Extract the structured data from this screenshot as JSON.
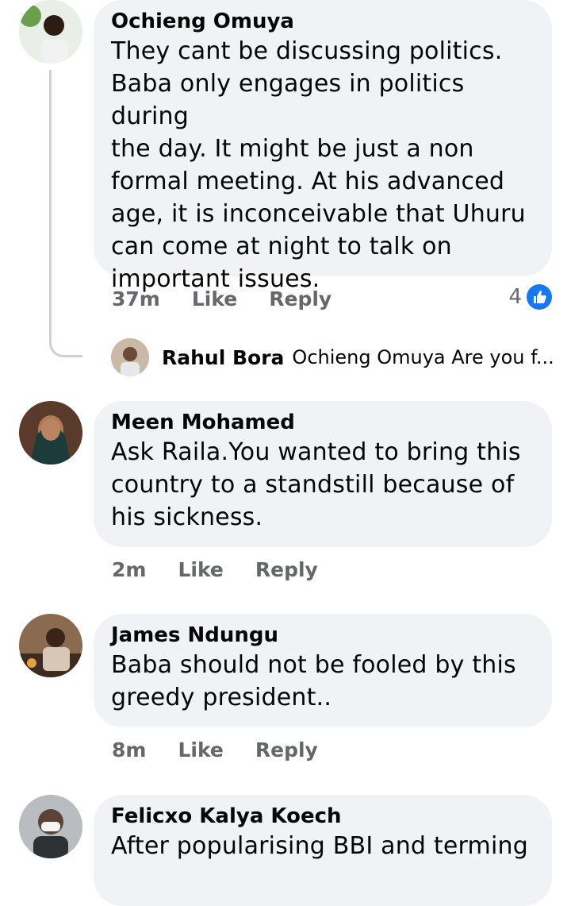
{
  "comments": [
    {
      "author": "Ochieng Omuya",
      "lines": [
        "They cant be discussing politics.",
        "Baba only engages in politics during",
        "the day. It might be just a non",
        "formal meeting. At his advanced",
        "age, it is inconceivable that Uhuru",
        "can come at night to talk on",
        "important issues."
      ],
      "time": "37m",
      "like_label": "Like",
      "reply_label": "Reply",
      "reaction_count": "4",
      "reply_preview": {
        "author": "Rahul Bora",
        "snippet": "Ochieng Omuya Are you f..."
      }
    },
    {
      "author": "Meen Mohamed",
      "lines": [
        "Ask Raila.You wanted to bring this",
        "country to a standstill because of",
        "his sickness."
      ],
      "time": "2m",
      "like_label": "Like",
      "reply_label": "Reply"
    },
    {
      "author": "James Ndungu",
      "lines": [
        "Baba should not be fooled by this",
        "greedy president.."
      ],
      "time": "8m",
      "like_label": "Like",
      "reply_label": "Reply"
    },
    {
      "author": "Felicxo Kalya Koech",
      "lines": [
        "After popularising BBI and terming"
      ]
    }
  ],
  "colors": {
    "bubble": "#f0f2f5",
    "meta_text": "#65676b",
    "like_blue": "#1877f2"
  }
}
